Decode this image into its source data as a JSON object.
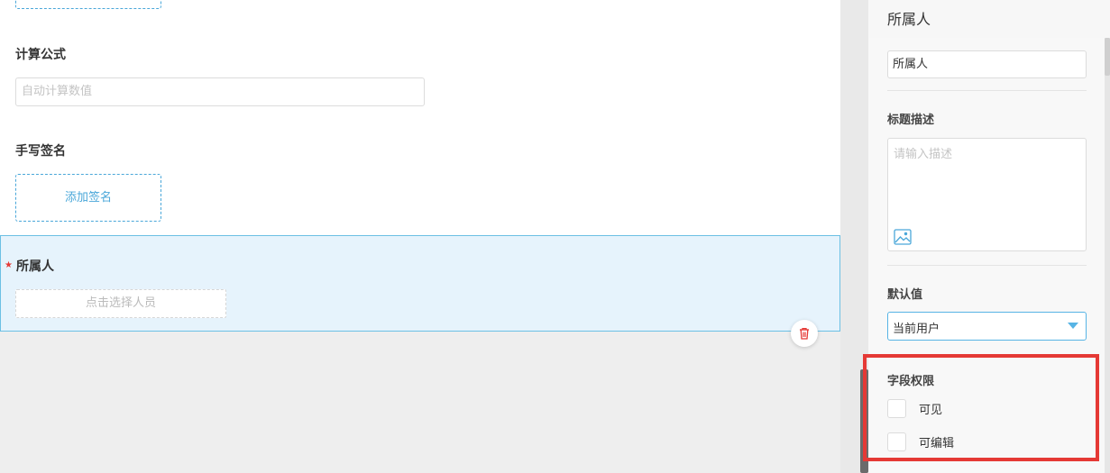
{
  "form": {
    "calc_field": {
      "label": "计算公式",
      "placeholder": "自动计算数值"
    },
    "sign_field": {
      "label": "手写签名",
      "button_label": "添加签名"
    },
    "owner_field": {
      "required_mark": "★",
      "label": "所属人",
      "placeholder": "点击选择人员"
    }
  },
  "panel": {
    "title": "所属人",
    "name_value": "所属人",
    "title_desc": {
      "label": "标题描述",
      "placeholder": "请输入描述"
    },
    "default_value": {
      "label": "默认值",
      "selected": "当前用户"
    },
    "permissions": {
      "label": "字段权限",
      "options": [
        {
          "label": "可见",
          "checked": false
        },
        {
          "label": "可编辑",
          "checked": false
        }
      ]
    }
  },
  "icons": {
    "delete": "trash-icon",
    "image": "image-icon",
    "caret": "chevron-down-icon"
  },
  "colors": {
    "accent": "#4aa7d9",
    "selected_bg": "#e6f3fc",
    "highlight": "#e53935",
    "delete_icon": "#e53935"
  }
}
